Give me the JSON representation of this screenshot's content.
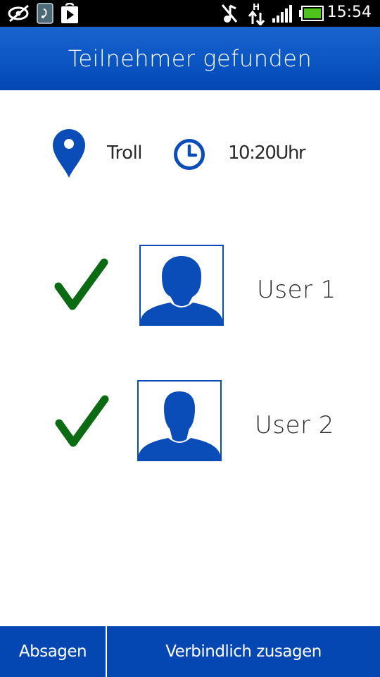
{
  "status_bar": {
    "time": "15:54",
    "icons": [
      "eye-slash-icon",
      "nfc-icon",
      "play-store-icon",
      "mute-icon",
      "data-h-arrows-icon",
      "signal-icon",
      "battery-icon"
    ]
  },
  "header": {
    "title": "Teilnehmer gefunden"
  },
  "info": {
    "location": "Troll",
    "time": "10:20Uhr",
    "location_icon": "map-pin-icon",
    "time_icon": "clock-icon"
  },
  "participants": [
    {
      "name": "User 1",
      "status": "confirmed",
      "status_icon": "checkmark-icon",
      "avatar_icon": "user-silhouette-icon"
    },
    {
      "name": "User 2",
      "status": "confirmed",
      "status_icon": "checkmark-icon",
      "avatar_icon": "user-silhouette-icon"
    }
  ],
  "actions": {
    "cancel_label": "Absagen",
    "confirm_label": "Verbindlich zusagen"
  },
  "colors": {
    "brand_blue": "#0a4db8",
    "check_green": "#0b6b12",
    "status_bar": "#000000",
    "text": "#2b2b2b"
  }
}
